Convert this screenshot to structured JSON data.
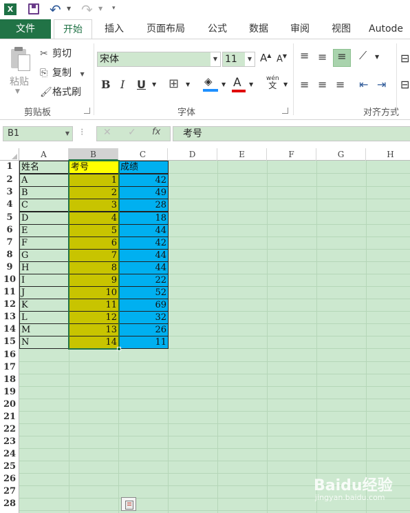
{
  "quick_access": {
    "app_icon": "X",
    "icons": [
      "excel-icon",
      "save-icon",
      "undo-icon",
      "redo-icon",
      "customize-icon"
    ]
  },
  "tabs": [
    "文件",
    "开始",
    "插入",
    "页面布局",
    "公式",
    "数据",
    "审阅",
    "视图",
    "Autode"
  ],
  "active_tab": "开始",
  "ribbon": {
    "clipboard": {
      "paste": "粘贴",
      "cut": "剪切",
      "copy": "复制",
      "format_painter": "格式刷",
      "group": "剪贴板"
    },
    "font": {
      "name": "宋体",
      "size": "11",
      "bold": "B",
      "italic": "I",
      "underline": "U",
      "group": "字体",
      "phonetic_top": "wén",
      "phonetic_bottom": "文"
    },
    "alignment": {
      "group": "对齐方式"
    },
    "colors": {
      "fill": "#ffff00",
      "font": "#ff0000",
      "accent": "#217346"
    }
  },
  "formula_bar": {
    "name_box": "B1",
    "formula": "考号",
    "fx": "fx"
  },
  "columns": [
    "A",
    "B",
    "C",
    "D",
    "E",
    "F",
    "G",
    "H"
  ],
  "rows": [
    "1",
    "2",
    "3",
    "4",
    "5",
    "6",
    "7",
    "8",
    "9",
    "10",
    "11",
    "12",
    "13",
    "14",
    "15",
    "16",
    "17",
    "18",
    "19",
    "20",
    "21",
    "22",
    "23",
    "24",
    "25",
    "26",
    "27",
    "28"
  ],
  "table": {
    "headers": [
      "姓名",
      "考号",
      "成绩"
    ],
    "rows": [
      [
        "A",
        "1",
        "42"
      ],
      [
        "B",
        "2",
        "49"
      ],
      [
        "C",
        "3",
        "28"
      ],
      [
        "D",
        "4",
        "18"
      ],
      [
        "E",
        "5",
        "44"
      ],
      [
        "F",
        "6",
        "42"
      ],
      [
        "G",
        "7",
        "44"
      ],
      [
        "H",
        "8",
        "44"
      ],
      [
        "I",
        "9",
        "22"
      ],
      [
        "J",
        "10",
        "52"
      ],
      [
        "K",
        "11",
        "69"
      ],
      [
        "L",
        "12",
        "32"
      ],
      [
        "M",
        "13",
        "26"
      ],
      [
        "N",
        "14",
        "11"
      ]
    ]
  },
  "cell_colors": {
    "B1": "#ffff00",
    "B_data": "#c8c400",
    "C": "#00b0f0"
  },
  "watermark": {
    "text": "Baidu经验",
    "sub": "jingyan.baidu.com"
  }
}
